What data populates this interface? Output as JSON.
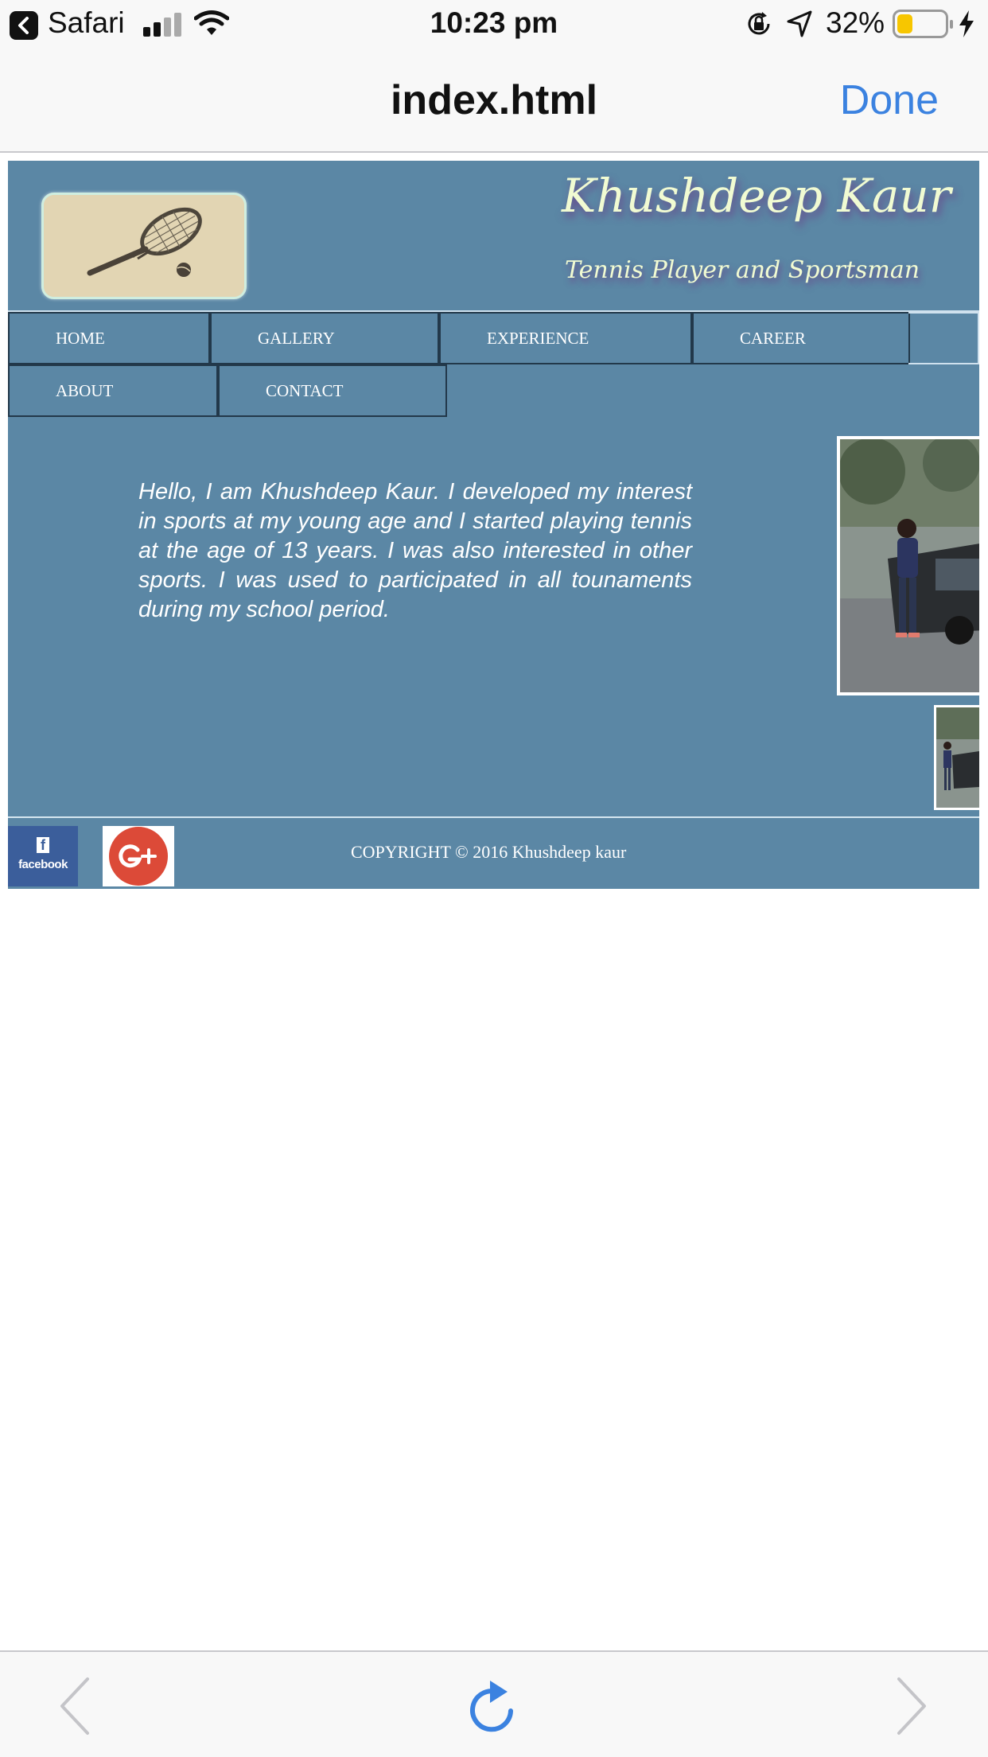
{
  "status_bar": {
    "back_app": "Safari",
    "time": "10:23 pm",
    "battery_percent_label": "32%",
    "battery_level": 0.32,
    "icons": [
      "back-icon",
      "signal-icon",
      "wifi-icon",
      "rotation-lock-icon",
      "location-icon",
      "battery-icon",
      "charging-icon"
    ]
  },
  "nav_header": {
    "title": "index.html",
    "done_label": "Done",
    "accent_color": "#3b82e0"
  },
  "site": {
    "background_color": "#5b87a5",
    "title": "Khushdeep Kaur",
    "subtitle": "Tennis Player and Sportsman",
    "menu": [
      {
        "label": "HOME"
      },
      {
        "label": "GALLERY"
      },
      {
        "label": "EXPERIENCE"
      },
      {
        "label": "CAREER"
      },
      {
        "label": "ABOUT"
      },
      {
        "label": "CONTACT"
      }
    ],
    "intro": "Hello, I am Khushdeep Kaur. I developed my interest in sports at my young age and I started playing tennis at the age of 13 years. I was also interested in other sports. I was used to participated in all tounaments during my school period.",
    "facebook_label": "facebook",
    "facebook_f": "f",
    "copyright": "COPYRIGHT © 2016 Khushdeep kaur"
  },
  "toolbar": {
    "icons": [
      "back-arrow-icon",
      "reload-icon",
      "forward-arrow-icon"
    ]
  }
}
